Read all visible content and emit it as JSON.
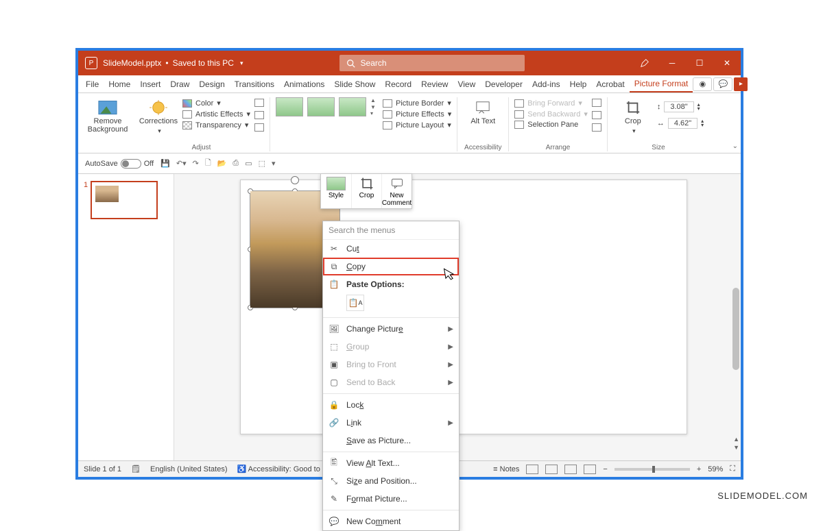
{
  "title": {
    "filename": "SlideModel.pptx",
    "saved": "Saved to this PC"
  },
  "search": {
    "placeholder": "Search"
  },
  "tabs": [
    "File",
    "Home",
    "Insert",
    "Draw",
    "Design",
    "Transitions",
    "Animations",
    "Slide Show",
    "Record",
    "Review",
    "View",
    "Developer",
    "Add-ins",
    "Help",
    "Acrobat",
    "Picture Format"
  ],
  "active_tab": "Picture Format",
  "ribbon": {
    "remove_bg": "Remove Background",
    "corrections": "Corrections",
    "adjust_label": "Adjust",
    "color": "Color",
    "artistic": "Artistic Effects",
    "transparency": "Transparency",
    "border": "Picture Border",
    "effects": "Picture Effects",
    "layout": "Picture Layout",
    "alt_text": "Alt Text",
    "accessibility_label": "Accessibility",
    "bring_forward": "Bring Forward",
    "send_backward": "Send Backward",
    "selection_pane": "Selection Pane",
    "arrange_label": "Arrange",
    "crop": "Crop",
    "size_label": "Size",
    "height": "3.08\"",
    "width": "4.62\""
  },
  "mini_toolbar": {
    "style": "Style",
    "crop": "Crop",
    "new_comment": "New Comment"
  },
  "qat": {
    "autosave": "AutoSave",
    "state": "Off"
  },
  "thumb": {
    "num": "1"
  },
  "context_menu": {
    "search": "Search the menus",
    "cut": "Cut",
    "copy": "Copy",
    "paste_options": "Paste Options:",
    "change_picture": "Change Picture",
    "group": "Group",
    "bring_front": "Bring to Front",
    "send_back": "Send to Back",
    "lock": "Lock",
    "link": "Link",
    "save_as_picture": "Save as Picture...",
    "view_alt_text": "View Alt Text...",
    "size_position": "Size and Position...",
    "format_picture": "Format Picture...",
    "new_comment": "New Comment"
  },
  "status": {
    "slide": "Slide 1 of 1",
    "lang": "English (United States)",
    "accessibility": "Accessibility: Good to go",
    "notes": "Notes",
    "zoom": "59%"
  },
  "watermark": "SLIDEMODEL.COM"
}
